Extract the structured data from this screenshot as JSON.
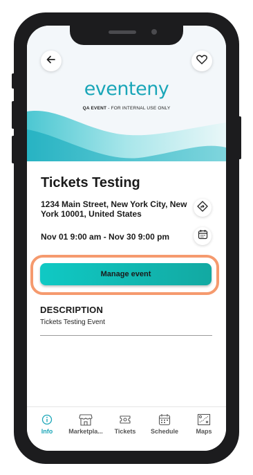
{
  "app": {
    "logo_text": "eventeny",
    "subtitle_bold": "QA EVENT",
    "subtitle_rest": " - FOR INTERNAL USE ONLY"
  },
  "event": {
    "title": "Tickets Testing",
    "address": "1234 Main Street, New York City, New York 10001, United States",
    "dates": "Nov 01 9:00 am - Nov 30 9:00 pm"
  },
  "actions": {
    "manage_label": "Manage event"
  },
  "description": {
    "heading": "DESCRIPTION",
    "text": "Tickets Testing Event"
  },
  "tabs": [
    {
      "label": "Info",
      "icon": "info-icon",
      "active": true
    },
    {
      "label": "Marketpla...",
      "icon": "storefront-icon",
      "active": false
    },
    {
      "label": "Tickets",
      "icon": "ticket-icon",
      "active": false
    },
    {
      "label": "Schedule",
      "icon": "calendar-icon",
      "active": false
    },
    {
      "label": "Maps",
      "icon": "map-icon",
      "active": false
    }
  ],
  "colors": {
    "accent": "#1aa6b8",
    "button": "#10c9c4",
    "highlight": "#f59a6e"
  }
}
